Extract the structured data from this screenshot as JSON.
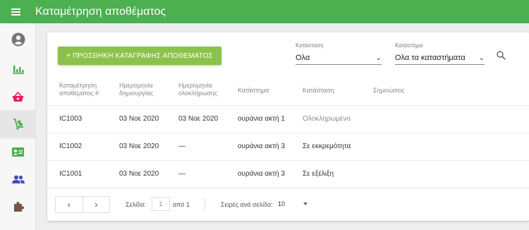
{
  "header": {
    "title": "Καταμέτρηση αποθέματος"
  },
  "toolbar": {
    "add_button_label": "+ ΠΡΟΣΘΗΚΗ ΚΑΤΑΓΡΑΦΗΣ ΑΠΟΘΕΜΑΤΟΣ",
    "status_filter": {
      "label": "Κατάσταση",
      "value": "Ολα"
    },
    "store_filter": {
      "label": "Κατάστημα",
      "value": "Ολα τα καταστήματα"
    }
  },
  "table": {
    "columns": [
      [
        "Καταμέτρηση",
        "αποθέματος #"
      ],
      [
        "Ημερομηνία",
        "δημιουργίας"
      ],
      [
        "Ημερομηνία",
        "ολοκλήρωσης"
      ],
      [
        "Κατάστημα"
      ],
      [
        "Κατάσταση"
      ],
      [
        "Σημειώσεις"
      ]
    ],
    "rows": [
      {
        "id": "IC1003",
        "created": "03 Νοε 2020",
        "completed": "03 Νοε 2020",
        "store": "ουράνια ακτή 1",
        "status": "Ολοκληρωμένο",
        "notes": ""
      },
      {
        "id": "IC1002",
        "created": "03 Νοε 2020",
        "completed": "—",
        "store": "ουράνια ακτή 3",
        "status": "Σε εκκρεμότητα",
        "notes": ""
      },
      {
        "id": "IC1001",
        "created": "03 Νοε 2020",
        "completed": "—",
        "store": "ουράνια ακτή 3",
        "status": "Σε εξέλιξη",
        "notes": ""
      }
    ]
  },
  "pagination": {
    "prev": "‹",
    "next": "›",
    "page_label": "Σελίδα:",
    "page_value": "1",
    "of_label": "από 1",
    "rows_label": "Σειρές ανά σελίδα:",
    "rows_value": "10"
  },
  "sidebar": {
    "items": [
      {
        "icon": "account-icon"
      },
      {
        "icon": "bar-chart-icon"
      },
      {
        "icon": "basket-icon"
      },
      {
        "icon": "inventory-cart-icon"
      },
      {
        "icon": "contact-card-icon"
      },
      {
        "icon": "people-icon"
      },
      {
        "icon": "puzzle-icon"
      }
    ]
  },
  "colors": {
    "appbar": "#4caf50",
    "accent_button": "#8bc34a",
    "basket": "#e91e63",
    "icons": "#4caf50",
    "people": "#3f51b5",
    "puzzle": "#795548"
  }
}
